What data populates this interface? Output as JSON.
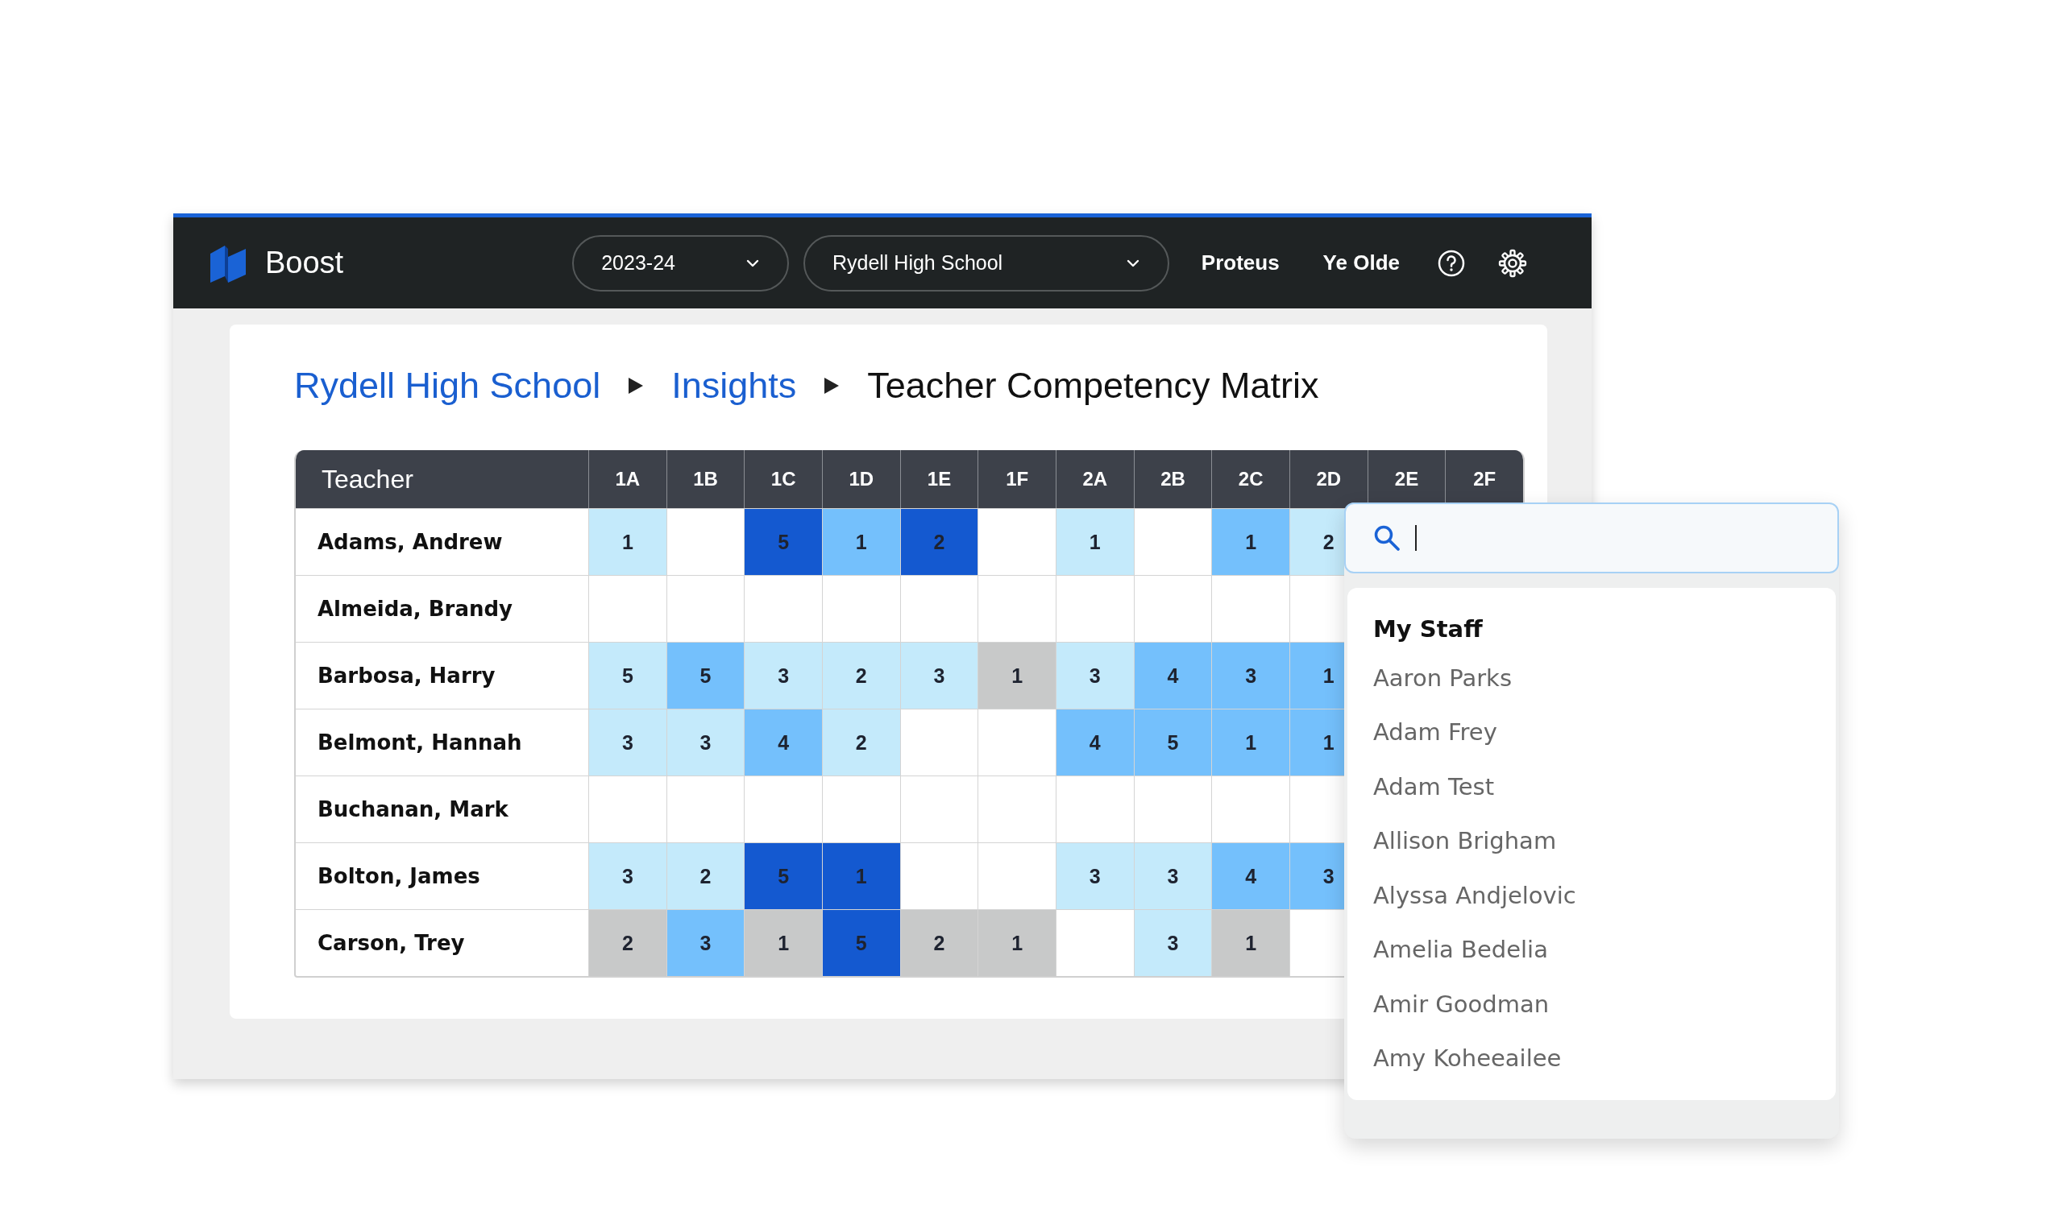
{
  "app": {
    "name": "Boost"
  },
  "header": {
    "year_select": "2023-24",
    "school_select": "Rydell High School",
    "links": [
      "Proteus",
      "Ye Olde"
    ]
  },
  "breadcrumb": [
    {
      "label": "Rydell High School",
      "kind": "link"
    },
    {
      "label": "Insights",
      "kind": "link"
    },
    {
      "label": "Teacher Competency Matrix",
      "kind": "current"
    }
  ],
  "table": {
    "columns": [
      "Teacher",
      "1A",
      "1B",
      "1C",
      "1D",
      "1E",
      "1F",
      "2A",
      "2B",
      "2C",
      "2D",
      "2E",
      "2F"
    ],
    "rows": [
      {
        "cells": [
          {
            "value": "Adams, Andrew",
            "kind": "name"
          },
          {
            "value": "1",
            "color": "#c4eafb"
          },
          {},
          {
            "value": "5",
            "color": "#1459d0"
          },
          {
            "value": "1",
            "color": "#74c0fc"
          },
          {
            "value": "2",
            "color": "#1459d0"
          },
          {},
          {
            "value": "1",
            "color": "#c4eafb"
          },
          {},
          {
            "value": "1",
            "color": "#74c0fc"
          },
          {
            "value": "2",
            "color": "#c4eafb"
          }
        ]
      },
      {
        "cells": [
          {
            "value": "Almeida, Brandy",
            "kind": "name"
          },
          {},
          {},
          {},
          {},
          {},
          {},
          {},
          {},
          {},
          {}
        ]
      },
      {
        "cells": [
          {
            "value": "Barbosa, Harry",
            "kind": "name"
          },
          {
            "value": "5",
            "color": "#c4eafb"
          },
          {
            "value": "5",
            "color": "#74c0fc"
          },
          {
            "value": "3",
            "color": "#c4eafb"
          },
          {
            "value": "2",
            "color": "#c4eafb"
          },
          {
            "value": "3",
            "color": "#c4eafb"
          },
          {
            "value": "1",
            "color": "#c8c9c9"
          },
          {
            "value": "3",
            "color": "#c4eafb"
          },
          {
            "value": "4",
            "color": "#74c0fc"
          },
          {
            "value": "3",
            "color": "#74c0fc"
          },
          {
            "value": "1",
            "color": "#74c0fc"
          }
        ]
      },
      {
        "cells": [
          {
            "value": "Belmont, Hannah",
            "kind": "name"
          },
          {
            "value": "3",
            "color": "#c4eafb"
          },
          {
            "value": "3",
            "color": "#c4eafb"
          },
          {
            "value": "4",
            "color": "#74c0fc"
          },
          {
            "value": "2",
            "color": "#c4eafb"
          },
          {},
          {},
          {
            "value": "4",
            "color": "#74c0fc"
          },
          {
            "value": "5",
            "color": "#74c0fc"
          },
          {
            "value": "1",
            "color": "#74c0fc"
          },
          {
            "value": "1",
            "color": "#74c0fc"
          }
        ]
      },
      {
        "cells": [
          {
            "value": "Buchanan, Mark",
            "kind": "name"
          },
          {},
          {},
          {},
          {},
          {},
          {},
          {},
          {},
          {},
          {}
        ]
      },
      {
        "cells": [
          {
            "value": "Bolton, James",
            "kind": "name"
          },
          {
            "value": "3",
            "color": "#c4eafb"
          },
          {
            "value": "2",
            "color": "#c4eafb"
          },
          {
            "value": "5",
            "color": "#1459d0"
          },
          {
            "value": "1",
            "color": "#1459d0"
          },
          {},
          {},
          {
            "value": "3",
            "color": "#c4eafb"
          },
          {
            "value": "3",
            "color": "#c4eafb"
          },
          {
            "value": "4",
            "color": "#74c0fc"
          },
          {
            "value": "3",
            "color": "#74c0fc"
          }
        ]
      },
      {
        "cells": [
          {
            "value": "Carson, Trey",
            "kind": "name"
          },
          {
            "value": "2",
            "color": "#c8c9c9"
          },
          {
            "value": "3",
            "color": "#74c0fc"
          },
          {
            "value": "1",
            "color": "#c8c9c9"
          },
          {
            "value": "5",
            "color": "#1459d0"
          },
          {
            "value": "2",
            "color": "#c8c9c9"
          },
          {
            "value": "1",
            "color": "#c8c9c9"
          },
          {},
          {
            "value": "3",
            "color": "#c4eafb"
          },
          {
            "value": "1",
            "color": "#c8c9c9"
          },
          {}
        ]
      }
    ]
  },
  "staff_picker": {
    "group": "My Staff",
    "items": [
      "Aaron Parks",
      "Adam Frey",
      "Adam Test",
      "Allison Brigham",
      "Alyssa Andjelovic",
      "Amelia Bedelia",
      "Amir Goodman",
      "Amy Koheeailee"
    ]
  }
}
